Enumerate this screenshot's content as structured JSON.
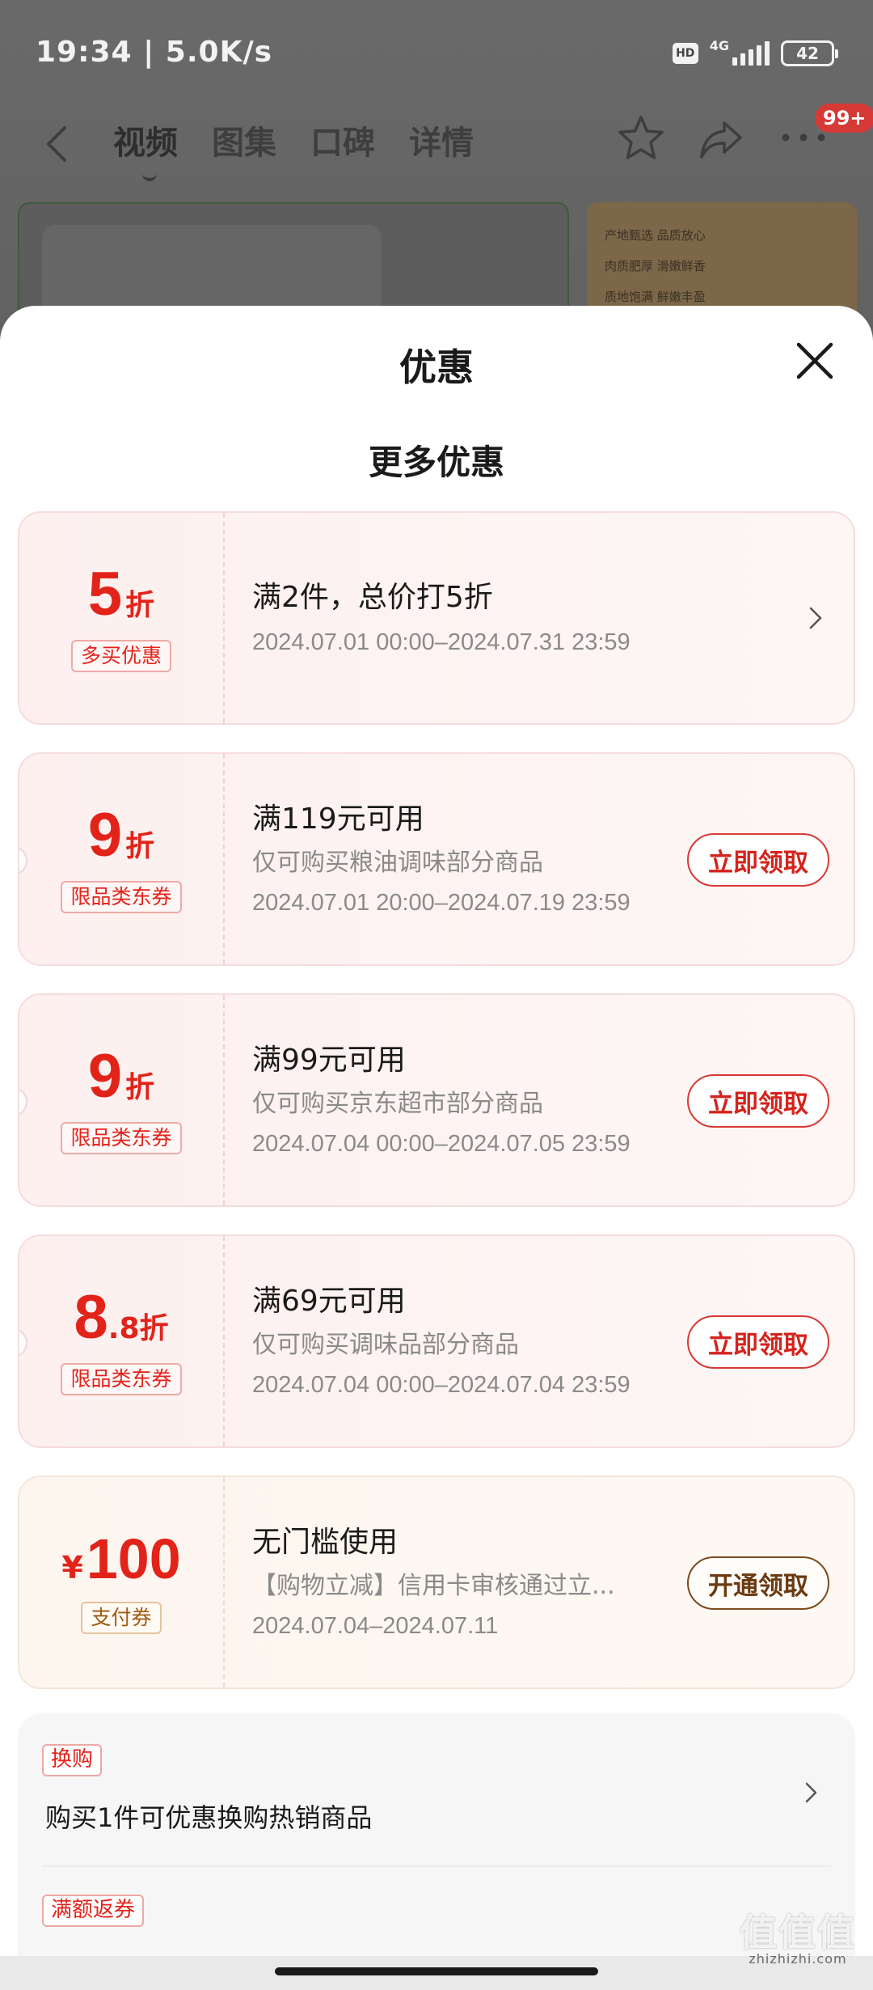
{
  "status_bar": {
    "time_speed": "19:34 | 5.0K/s",
    "hd": "HD",
    "network": "4G",
    "battery": "42"
  },
  "nav": {
    "tabs": [
      {
        "label": "视频",
        "active": true
      },
      {
        "label": "图集"
      },
      {
        "label": "口碑"
      },
      {
        "label": "详情"
      }
    ],
    "more_badge": "99+"
  },
  "background_card": {
    "lines": [
      "产地甄选  品质放心",
      "肉质肥厚  滑嫩鲜香",
      "质地饱满  鲜嫩丰盈"
    ]
  },
  "sheet": {
    "title": "优惠",
    "section_title": "更多优惠",
    "coupons": [
      {
        "value_main": "5",
        "value_unit": "折",
        "tag": "多买优惠",
        "condition": "满2件，总价打5折",
        "date": "2024.07.01 00:00–2024.07.31 23:59",
        "action": "chevron"
      },
      {
        "value_main": "9",
        "value_unit": "折",
        "tag": "限品类东券",
        "condition": "满119元可用",
        "desc": "仅可购买粮油调味部分商品",
        "date": "2024.07.01 20:00–2024.07.19 23:59",
        "button": "立即领取"
      },
      {
        "value_main": "9",
        "value_unit": "折",
        "tag": "限品类东券",
        "condition": "满99元可用",
        "desc": "仅可购买京东超市部分商品",
        "date": "2024.07.04 00:00–2024.07.05 23:59",
        "button": "立即领取"
      },
      {
        "value_main": "8",
        "value_decimal": ".8",
        "value_unit": "折",
        "tag": "限品类东券",
        "condition": "满69元可用",
        "desc": "仅可购买调味品部分商品",
        "date": "2024.07.04 00:00–2024.07.04 23:59",
        "button": "立即领取"
      },
      {
        "currency": "¥",
        "value_main": "100",
        "tag": "支付券",
        "condition": "无门槛使用",
        "desc": "【购物立减】信用卡审核通过立...",
        "date": "2024.07.04–2024.07.11",
        "button": "开通领取"
      }
    ],
    "promos": [
      {
        "tag": "换购",
        "text": "购买1件可优惠换购热销商品"
      },
      {
        "tag": "满额返券"
      }
    ]
  },
  "watermark": {
    "main": "值值值",
    "sub": "zhizhizhi.com"
  },
  "colors": {
    "accent": "#e2231a",
    "pay_button": "#6b3a12",
    "overlay": "#5e5e5e"
  }
}
